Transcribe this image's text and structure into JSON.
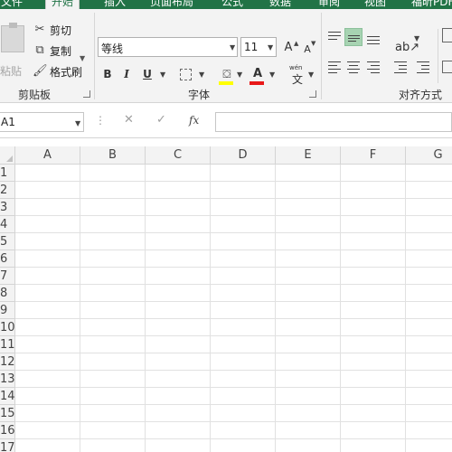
{
  "tabs": [
    "文件",
    "开始",
    "插入",
    "页面布局",
    "公式",
    "数据",
    "审阅",
    "视图",
    "福昕PDF"
  ],
  "clipboard": {
    "paste_label": "粘贴",
    "cut_label": "剪切",
    "copy_label": "复制",
    "format_painter_label": "格式刷",
    "group_label": "剪贴板"
  },
  "font": {
    "name": "等线",
    "size": "11",
    "bold": "B",
    "italic": "I",
    "underline": "U",
    "grow": "A",
    "shrink": "A",
    "color_letter": "A",
    "phonetic_top": "wén",
    "phonetic_char": "文",
    "group_label": "字体",
    "fill_color": "#ffff00",
    "font_color": "#e81818"
  },
  "alignment": {
    "group_label": "对齐方式",
    "selected": "middle-align"
  },
  "formula_bar": {
    "name_box": "A1",
    "cancel": "✕",
    "enter": "✓",
    "fx": "fx",
    "formula": ""
  },
  "grid": {
    "columns": [
      "A",
      "B",
      "C",
      "D",
      "E",
      "F",
      "G"
    ],
    "rows": [
      "1",
      "2",
      "3",
      "4",
      "5",
      "6",
      "7",
      "8",
      "9",
      "10",
      "11",
      "12",
      "13",
      "14",
      "15",
      "16",
      "17"
    ]
  },
  "colors": {
    "ribbon_tab_bg": "#217346",
    "ribbon_bg": "#f3f3f3",
    "selected_align_bg": "#a7d3b2"
  },
  "icons": {
    "cut": "scissors-icon",
    "copy": "copy-icon",
    "format_painter": "brush-icon",
    "paste": "clipboard-icon",
    "fill": "paint-bucket-icon",
    "border": "border-icon",
    "orientation": "text-orientation-icon"
  }
}
